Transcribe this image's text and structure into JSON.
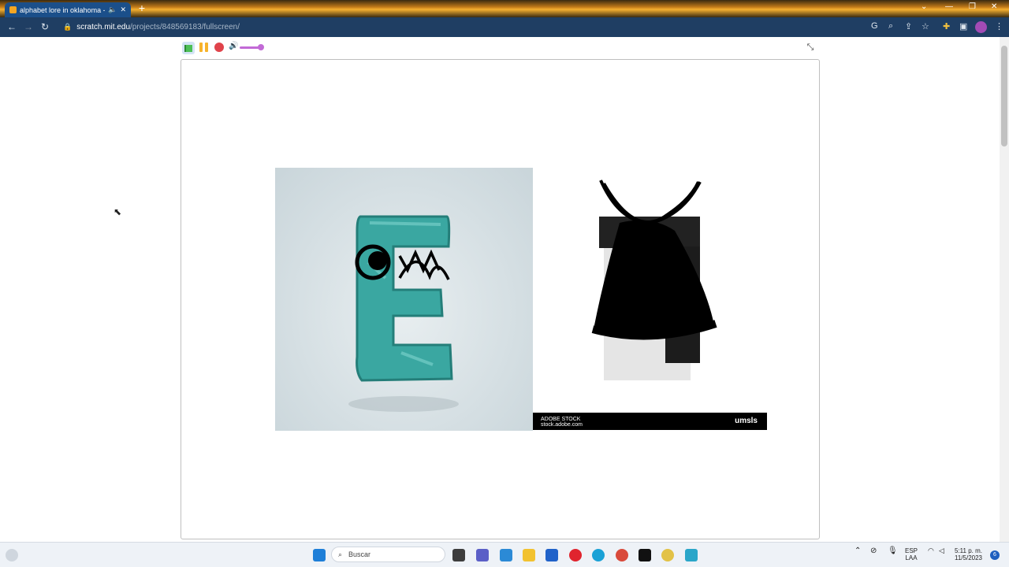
{
  "browser": {
    "tab_title": "alphabet lore in oklahoma -",
    "url_host": "scratch.mit.edu",
    "url_path": "/projects/848569183/fullscreen/",
    "new_tab_label": "+"
  },
  "stage": {
    "right_image_footer_left_line1": "ADOBE STOCK",
    "right_image_footer_left_line2": "stock.adobe.com",
    "right_image_footer_brand": "umsls"
  },
  "taskbar": {
    "search_placeholder": "Buscar",
    "lang_line1": "ESP",
    "lang_line2": "LAA",
    "time": "5:11 p. m.",
    "date": "11/5/2023",
    "notification_count": "6"
  },
  "colors": {
    "accent": "#1b4f8a",
    "green_flag": "#4cbf56",
    "pause": "#f7b32b",
    "stop": "#e0434b",
    "volume": "#c26ad6"
  }
}
